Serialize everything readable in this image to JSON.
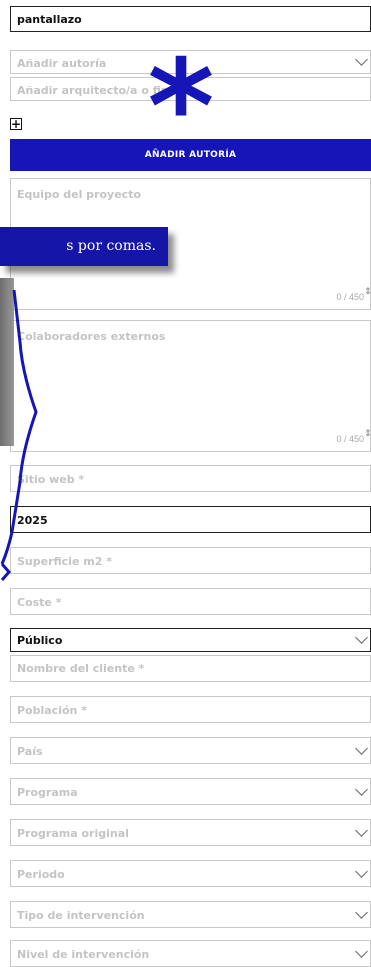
{
  "fields": {
    "title_value": "pantallazo",
    "authorship_select": "Añadir autoría",
    "architect_input": "Añadir arquitecto/a o firma",
    "add_plus": "+",
    "add_authorship_button": "AÑADIR AUTORÍA",
    "team_placeholder": "Equipo del proyecto",
    "team_counter": "0 / 450",
    "collaborators_placeholder": "Colaboradores externos",
    "collaborators_counter": "0 / 450",
    "website_placeholder": "Sitio web *",
    "year_value": "2025",
    "surface_placeholder": "Superficie m2 *",
    "cost_placeholder": "Coste *",
    "type_select": "Público",
    "client_placeholder": "Nombre del cliente *",
    "city_placeholder": "Población *",
    "country_select": "País",
    "program_select": "Programa",
    "original_program_select": "Programa original",
    "period_select": "Periodo",
    "intervention_type_select": "Tipo de intervención",
    "intervention_level_select": "Nivel de intervención"
  },
  "tooltip": {
    "text": "s por comas."
  },
  "overlay": {
    "asterisk": "*"
  },
  "colors": {
    "accent": "#1515b8",
    "placeholder": "#c4c4c4",
    "border": "#c9c9c9"
  }
}
